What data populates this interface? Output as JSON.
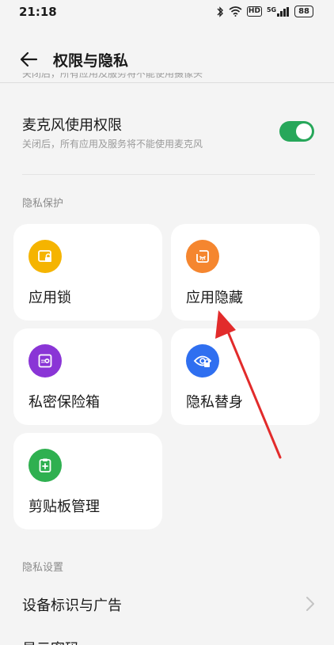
{
  "status": {
    "time": "21:18",
    "network_badge": "HD",
    "signal_badge": "5G",
    "battery": "88"
  },
  "header": {
    "title": "权限与隐私"
  },
  "camera_cutoff_text": "关闭后，所有应用及服务将不能使用摄像头",
  "microphone": {
    "title": "麦克风使用权限",
    "subtitle": "关闭后，所有应用及服务将不能使用麦克风",
    "enabled": true,
    "toggle_color": "#27a75a"
  },
  "privacy_protection": {
    "section_title": "隐私保护",
    "cards": [
      {
        "label": "应用锁",
        "icon": "app-lock-icon",
        "color": "#f5b400"
      },
      {
        "label": "应用隐藏",
        "icon": "app-hide-icon",
        "color": "#f5862f"
      },
      {
        "label": "私密保险箱",
        "icon": "private-safe-icon",
        "color": "#8a35d6"
      },
      {
        "label": "隐私替身",
        "icon": "privacy-double-icon",
        "color": "#2f6ff0"
      },
      {
        "label": "剪贴板管理",
        "icon": "clipboard-icon",
        "color": "#2fb050"
      }
    ]
  },
  "privacy_settings": {
    "section_title": "隐私设置",
    "items": [
      {
        "label": "设备标识与广告"
      },
      {
        "label": "显示密码"
      }
    ]
  },
  "annotation_color": "#e22b2b"
}
